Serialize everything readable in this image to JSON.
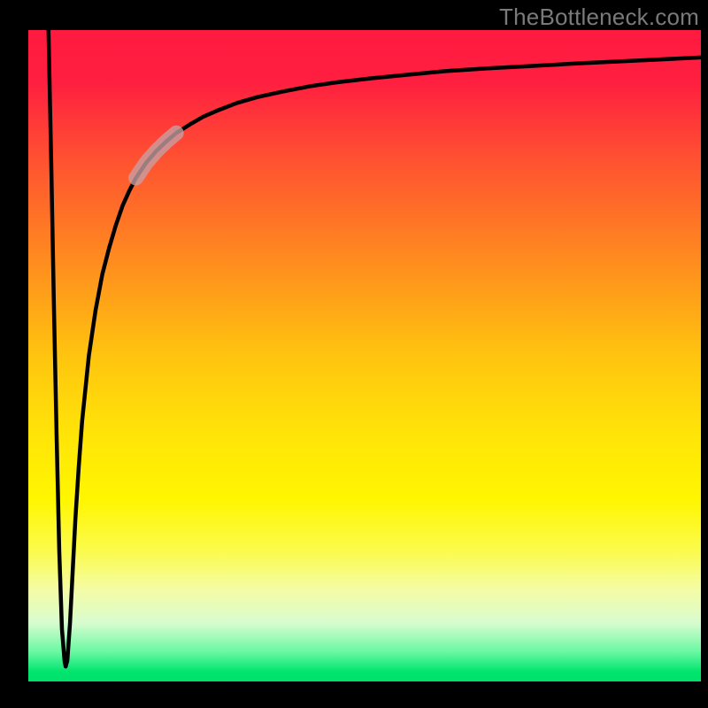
{
  "attribution": "TheBottleneck.com",
  "chart_data": {
    "type": "line",
    "title": "",
    "xlabel": "",
    "ylabel": "",
    "xlim": [
      0,
      100
    ],
    "ylim": [
      0,
      100
    ],
    "grid": false,
    "legend": false,
    "gradient_stops": [
      {
        "offset": 0.0,
        "color": "#ff1a3f"
      },
      {
        "offset": 0.08,
        "color": "#ff1f40"
      },
      {
        "offset": 0.2,
        "color": "#ff5231"
      },
      {
        "offset": 0.35,
        "color": "#ff8a1f"
      },
      {
        "offset": 0.5,
        "color": "#ffc40f"
      },
      {
        "offset": 0.62,
        "color": "#ffe408"
      },
      {
        "offset": 0.72,
        "color": "#fff600"
      },
      {
        "offset": 0.8,
        "color": "#fbfb4d"
      },
      {
        "offset": 0.86,
        "color": "#f4fca6"
      },
      {
        "offset": 0.91,
        "color": "#d8fccf"
      },
      {
        "offset": 0.955,
        "color": "#68f8a2"
      },
      {
        "offset": 0.985,
        "color": "#00e56e"
      },
      {
        "offset": 1.0,
        "color": "#00e06c"
      }
    ],
    "series": [
      {
        "name": "curve",
        "x": [
          3.0,
          3.4,
          3.8,
          4.2,
          4.6,
          5.0,
          5.4,
          5.55,
          5.8,
          6.2,
          6.6,
          7.0,
          7.5,
          8.0,
          9.0,
          10.0,
          11.0,
          12.0,
          13.0,
          14.0,
          15.0,
          16.0,
          17.5,
          19.0,
          20.5,
          22.0,
          24.0,
          26.0,
          28.0,
          31.0,
          34.0,
          38.0,
          42.0,
          46.0,
          51.0,
          56.0,
          62.0,
          68.0,
          75.0,
          82.0,
          90.0,
          100.0
        ],
        "y": [
          100.0,
          80.0,
          58.0,
          38.0,
          20.0,
          8.0,
          3.0,
          2.3,
          3.2,
          9.0,
          17.0,
          25.0,
          33.0,
          40.0,
          50.0,
          57.0,
          62.5,
          66.5,
          70.0,
          73.0,
          75.3,
          77.3,
          79.6,
          81.4,
          82.9,
          84.2,
          85.5,
          86.7,
          87.6,
          88.8,
          89.7,
          90.6,
          91.4,
          92.0,
          92.6,
          93.1,
          93.7,
          94.1,
          94.5,
          94.9,
          95.3,
          95.8
        ]
      }
    ],
    "highlight_segment": {
      "x_start": 16.0,
      "x_end": 22.0
    },
    "dip_min": {
      "x": 5.55,
      "y": 2.3
    }
  },
  "frame": {
    "outer": 800,
    "margin_left": 32,
    "margin_right": 8,
    "margin_top": 34,
    "margin_bottom": 30
  }
}
